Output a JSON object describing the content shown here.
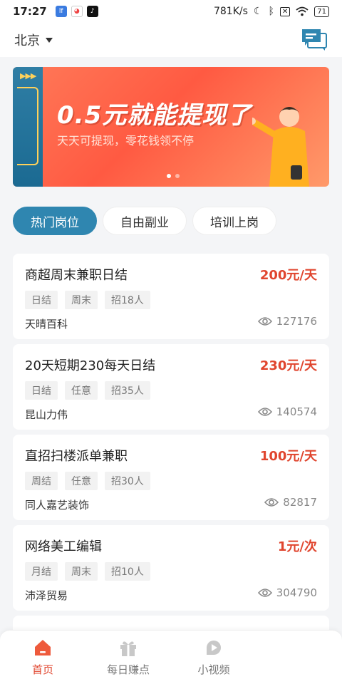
{
  "status_bar": {
    "time": "17:27",
    "network_speed": "781K/s",
    "battery": "71"
  },
  "header": {
    "city": "北京",
    "message_icon": "chat-icon"
  },
  "banner": {
    "title": "0.5元就能提现了",
    "subtitle": "天天可提现，零花钱领不停",
    "page_count": 2,
    "active_page": 1
  },
  "tabs": [
    {
      "label": "热门岗位",
      "active": true
    },
    {
      "label": "自由副业",
      "active": false
    },
    {
      "label": "培训上岗",
      "active": false
    }
  ],
  "jobs": [
    {
      "title": "商超周末兼职日结",
      "pay": "200元/天",
      "tags": [
        "日结",
        "周末",
        "招18人"
      ],
      "company": "天晴百科",
      "views": "127176"
    },
    {
      "title": "20天短期230每天日结",
      "pay": "230元/天",
      "tags": [
        "日结",
        "任意",
        "招35人"
      ],
      "company": "昆山力伟",
      "views": "140574"
    },
    {
      "title": "直招扫楼派单兼职",
      "pay": "100元/天",
      "tags": [
        "周结",
        "任意",
        "招30人"
      ],
      "company": "同人嘉艺装饰",
      "views": "82817"
    },
    {
      "title": "网络美工编辑",
      "pay": "1元/次",
      "tags": [
        "月结",
        "周末",
        "招10人"
      ],
      "company": "沛泽贸易",
      "views": "304790"
    }
  ],
  "bottom_nav": [
    {
      "label": "首页",
      "icon": "home-icon",
      "active": true
    },
    {
      "label": "每日赚点",
      "icon": "gift-icon",
      "active": false
    },
    {
      "label": "小视频",
      "icon": "video-icon",
      "active": false
    },
    {
      "label": "",
      "icon": "",
      "active": false
    }
  ],
  "colors": {
    "accent": "#2f86b0",
    "pay": "#e0452e",
    "banner": "#ff5a42"
  }
}
